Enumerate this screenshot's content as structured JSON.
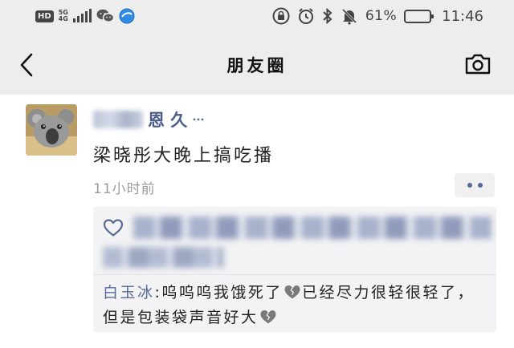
{
  "status_bar": {
    "hd": "HD",
    "network_top": "5G",
    "network_bottom": "4G",
    "battery_percent": "61%",
    "battery_level": 0.61,
    "time": "11:46"
  },
  "nav": {
    "title": "朋友圈",
    "back_icon": "chevron-left-icon",
    "camera_icon": "camera-icon"
  },
  "post": {
    "author_visible_suffix": "恩 久",
    "text": "梁晓彤大晚上搞吃播",
    "timestamp": "11小时前",
    "interactions": {
      "like_icon": "heart-icon",
      "comment": {
        "author": "白玉冰",
        "separator": ":",
        "part1": "呜呜呜我饿死了",
        "part2": "已经尽力很轻很轻了，但是包装袋声音好大",
        "emoji": "broken-heart-icon"
      }
    }
  },
  "colors": {
    "name_blue": "#576b95",
    "topbar_bg": "#ededed",
    "comment_bg": "#f3f3f5",
    "timestamp_gray": "#9b9b9b"
  }
}
